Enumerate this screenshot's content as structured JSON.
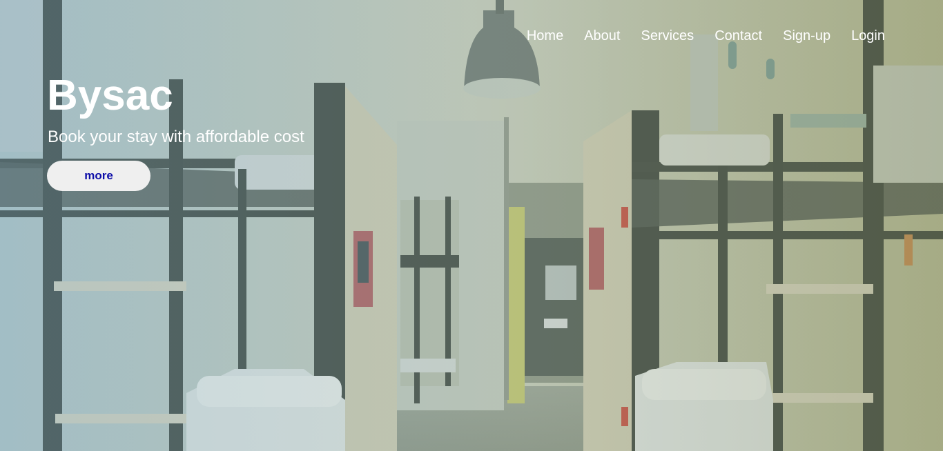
{
  "nav": {
    "items": [
      {
        "label": "Home"
      },
      {
        "label": "About"
      },
      {
        "label": "Services"
      },
      {
        "label": "Contact"
      },
      {
        "label": "Sign-up"
      },
      {
        "label": "Login"
      }
    ]
  },
  "hero": {
    "title": "Bysac",
    "subtitle": "Book your stay with affordable cost",
    "button_label": "more",
    "background_description_icon": "hostel-bunk-room-photo"
  },
  "colors": {
    "nav_text": "#ffffff",
    "button_bg": "#efefef",
    "button_text": "#0d0da8",
    "overlay": "#8fa9a8"
  }
}
